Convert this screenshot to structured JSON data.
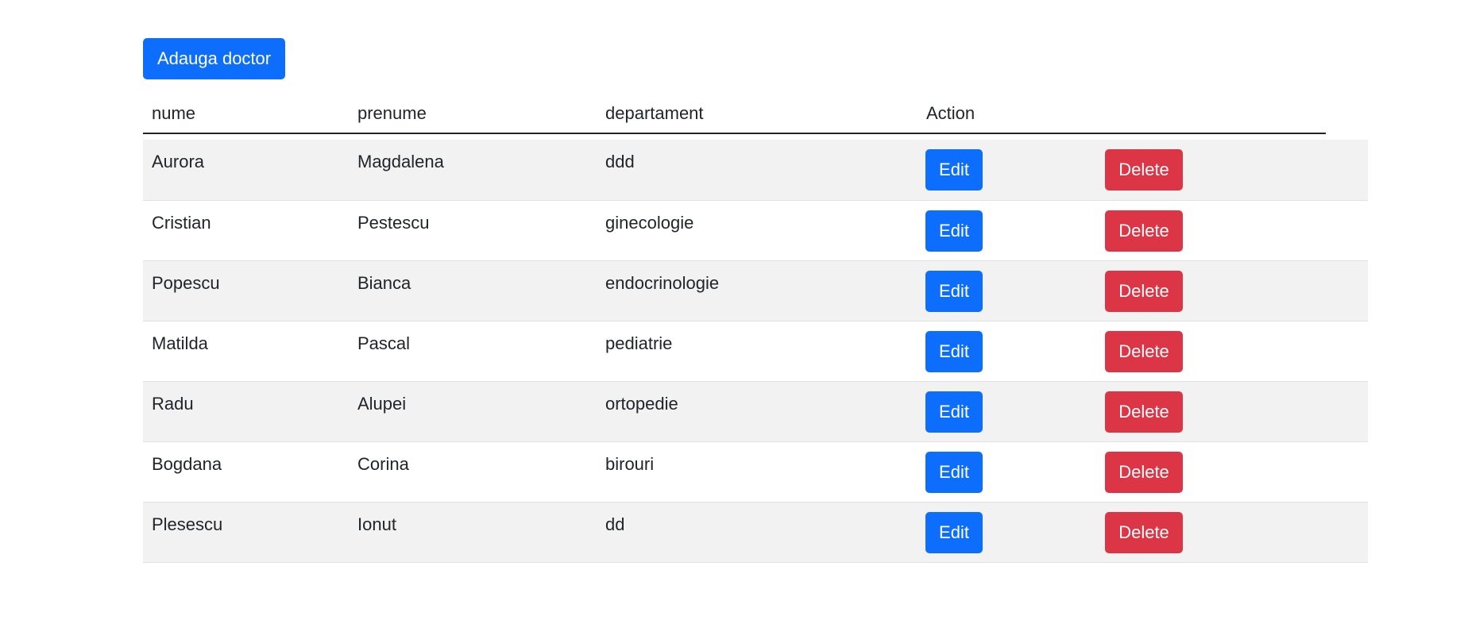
{
  "toolbar": {
    "add_label": "Adauga doctor"
  },
  "table": {
    "headers": [
      "nume",
      "prenume",
      "departament",
      "Action"
    ],
    "edit_label": "Edit",
    "delete_label": "Delete",
    "rows": [
      {
        "nume": "Aurora",
        "prenume": "Magdalena",
        "departament": "ddd"
      },
      {
        "nume": "Cristian",
        "prenume": "Pestescu",
        "departament": "ginecologie"
      },
      {
        "nume": "Popescu",
        "prenume": "Bianca",
        "departament": "endocrinologie"
      },
      {
        "nume": "Matilda",
        "prenume": "Pascal",
        "departament": "pediatrie"
      },
      {
        "nume": "Radu",
        "prenume": "Alupei",
        "departament": "ortopedie"
      },
      {
        "nume": "Bogdana",
        "prenume": "Corina",
        "departament": "birouri"
      },
      {
        "nume": "Plesescu",
        "prenume": "Ionut",
        "departament": "dd"
      }
    ]
  },
  "colors": {
    "primary": "#0d6efd",
    "danger": "#dc3545",
    "stripe": "#f2f2f2"
  }
}
